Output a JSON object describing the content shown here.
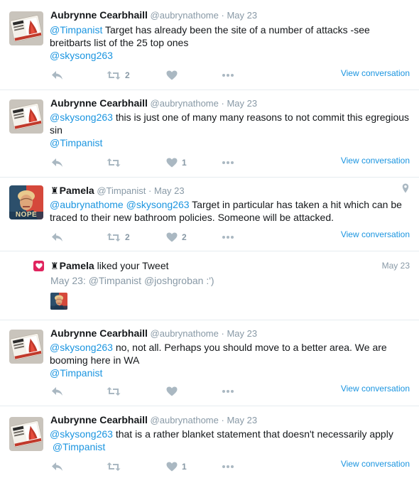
{
  "colors": {
    "link": "#1b95e0",
    "muted": "#8899a6",
    "icon": "#aab8c2",
    "like_badge": "#e0245e"
  },
  "view_conversation_label": "View conversation",
  "tweets": [
    {
      "name": "Aubrynne Cearbhaill",
      "handle": "@aubrynathome",
      "dot": "·",
      "date": "May 23",
      "mention1": "@Timpanist",
      "text1": " Target has already been the site of a number of attacks -see breitbarts list of the 25 top ones",
      "mention2": "@skysong263",
      "retweets": "2",
      "likes": ""
    },
    {
      "name": "Aubrynne Cearbhaill",
      "handle": "@aubrynathome",
      "dot": "·",
      "date": "May 23",
      "mention1": "@skysong263",
      "text1": " this is just one of many many reasons to not commit this egregious sin",
      "mention2": "@Timpanist",
      "retweets": "",
      "likes": "1"
    },
    {
      "name": "Pamela",
      "handle": "@Timpanist",
      "dot": "·",
      "date": "May 23",
      "mention1": "@aubrynathome",
      "mention1b": "@skysong263",
      "text1": " Target in particular has taken a hit which can be traced to their new bathroom policies. Someone will be attacked.",
      "retweets": "2",
      "likes": "2"
    },
    {
      "name": "Aubrynne Cearbhaill",
      "handle": "@aubrynathome",
      "dot": "·",
      "date": "May 23",
      "mention1": "@skysong263",
      "text1": " no, not all. Perhaps you should move to a better area. We are booming here in WA",
      "mention2": "@Timpanist",
      "retweets": "",
      "likes": ""
    },
    {
      "name": "Aubrynne Cearbhaill",
      "handle": "@aubrynathome",
      "dot": "·",
      "date": "May 23",
      "mention1": "@skysong263",
      "text1": " that is a rather blanket statement that doesn't necessarily apply",
      "mention2": "@Timpanist",
      "retweets": "",
      "likes": "1"
    }
  ],
  "notification": {
    "name": "Pamela",
    "action": " liked your Tweet",
    "date": "May 23",
    "sub": "May 23: @Timpanist @joshgroban :')"
  },
  "avatar_text": {
    "sticker_top": "ENOUGH",
    "sticker_bottom": "NEVER TRUMP",
    "nope": "NOPE"
  }
}
